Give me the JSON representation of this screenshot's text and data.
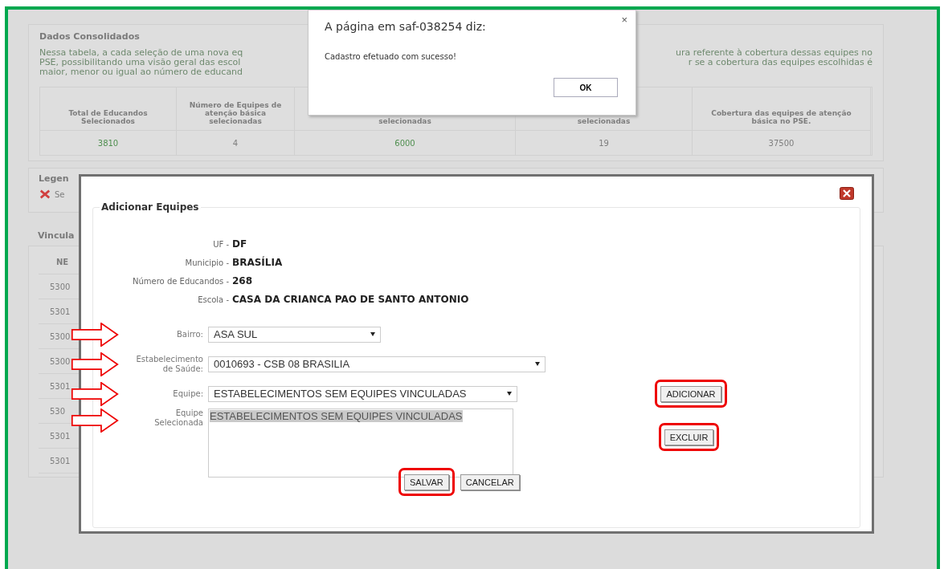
{
  "background_page": {
    "summary": {
      "title": "Dados Consolidados",
      "paragraph_lines": [
        [
          "Nessa tabela, a cada seleção de uma nova eq",
          "ura referente à cobertura dessas equipes no"
        ],
        [
          "PSE, possibilitando uma visão geral das escol",
          "r se a cobertura das equipes escolhidas é"
        ],
        [
          "maior, menor ou igual ao número de educand"
        ]
      ],
      "columns": [
        "Total de Educandos Selecionados",
        "Número de Equipes de atenção básica selecionadas",
        "selecionadas",
        "selecionadas",
        "Cobertura das equipes de atenção básica no PSE."
      ],
      "values": [
        {
          "text": "3810",
          "highlight": true
        },
        {
          "text": "4",
          "highlight": false
        },
        {
          "text": "6000",
          "highlight": true
        },
        {
          "text": "19",
          "highlight": false
        },
        {
          "text": "37500",
          "highlight": false
        }
      ]
    },
    "legend": {
      "title": "Legen",
      "item": "Se"
    },
    "linked": {
      "title": "Vincula",
      "column": "NE",
      "rows": [
        "5300",
        "5301",
        "5300",
        "5300",
        "5301",
        "530",
        "5301",
        "5301"
      ]
    }
  },
  "modal": {
    "legend": "Adicionar Equipes",
    "info": [
      {
        "label": "UF -",
        "value": "DF"
      },
      {
        "label": "Municipio -",
        "value": "BRASÍLIA"
      },
      {
        "label": "Número de Educandos -",
        "value": "268"
      },
      {
        "label": "Escola -",
        "value": "CASA DA CRIANCA PAO DE SANTO ANTONIO"
      }
    ],
    "fields": [
      {
        "kind": "select",
        "label": "Bairro:",
        "value": "ASA SUL",
        "annotated": true
      },
      {
        "kind": "select",
        "label": "Estabelecimento de Saúde:",
        "value": "0010693 - CSB 08 BRASILIA",
        "annotated": true
      },
      {
        "kind": "select",
        "label": "Equipe:",
        "value": "ESTABELECIMENTOS SEM EQUIPES VINCULADAS",
        "annotated": true,
        "button": {
          "label": "ADICIONAR",
          "highlighted": true
        }
      },
      {
        "kind": "listbox",
        "label": "Equipe Selecionada",
        "items": [
          {
            "text": "ESTABELECIMENTOS SEM EQUIPES VINCULADAS",
            "selected": true
          }
        ],
        "annotated": true,
        "button": {
          "label": "EXCLUIR",
          "highlighted": true
        }
      }
    ],
    "buttons": [
      {
        "label": "SALVAR",
        "highlighted": true
      },
      {
        "label": "CANCELAR",
        "highlighted": false
      }
    ]
  },
  "alert": {
    "title": "A página em saf-038254 diz:",
    "close": "×",
    "message": "Cadastro efetuado com sucesso!",
    "button": "OK"
  }
}
